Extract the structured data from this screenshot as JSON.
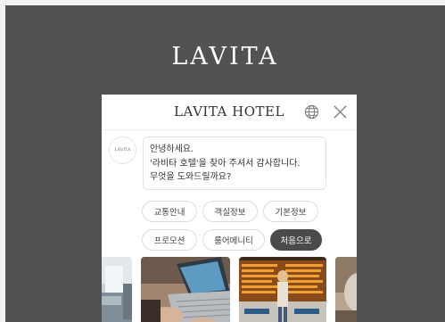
{
  "brand": {
    "logo_text": "LAVITA"
  },
  "chat": {
    "title": "LAVITA HOTEL",
    "avatar_text": "LAVITA",
    "greeting": [
      "안녕하세요.",
      "'라비타 호텔'을 찾아 주셔서 감사합니다.",
      "무엇을 도와드릴까요?"
    ],
    "quick_replies": [
      "교통안내",
      "객실정보",
      "기본정보",
      "프로모션",
      "룸어메니티",
      "처음으로"
    ]
  },
  "icons": {
    "globe": "globe-icon",
    "close": "close-icon"
  },
  "colors": {
    "backdrop": "#525252",
    "panel": "#ffffff",
    "accent_chip": "#4a4a4a"
  }
}
